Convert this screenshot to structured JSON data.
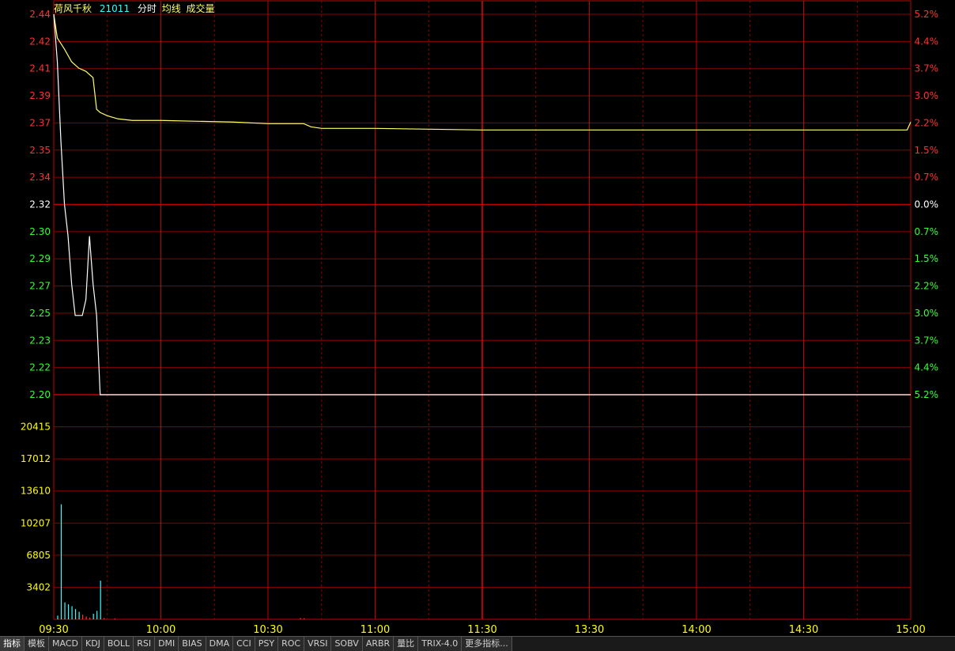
{
  "header": {
    "name": "荷风千秋",
    "code": "21011",
    "label_fenshi": "分时",
    "label_junxian": "均线",
    "label_volume": "成交量"
  },
  "colors": {
    "grid": "#8b0000",
    "grid_major": "#c00000",
    "price_line": "#ffffff",
    "avg_line": "#ffff66",
    "up": "#ff3030",
    "down": "#33ff33",
    "flat": "#ffffff",
    "volume_axis": "#ffff00",
    "volume_bar": "#33ffff",
    "volume_bar_red": "#ff3030",
    "time_label": "#ffff00"
  },
  "chart_data": {
    "type": "line",
    "prev_close": 2.32,
    "price_levels": [
      {
        "price": "2.44",
        "pct": "5.2%",
        "dir": "up"
      },
      {
        "price": "2.42",
        "pct": "4.4%",
        "dir": "up"
      },
      {
        "price": "2.41",
        "pct": "3.7%",
        "dir": "up"
      },
      {
        "price": "2.39",
        "pct": "3.0%",
        "dir": "up"
      },
      {
        "price": "2.37",
        "pct": "2.2%",
        "dir": "up"
      },
      {
        "price": "2.35",
        "pct": "1.5%",
        "dir": "up"
      },
      {
        "price": "2.34",
        "pct": "0.7%",
        "dir": "up"
      },
      {
        "price": "2.32",
        "pct": "0.0%",
        "dir": "flat"
      },
      {
        "price": "2.30",
        "pct": "0.7%",
        "dir": "down"
      },
      {
        "price": "2.29",
        "pct": "1.5%",
        "dir": "down"
      },
      {
        "price": "2.27",
        "pct": "2.2%",
        "dir": "down"
      },
      {
        "price": "2.25",
        "pct": "3.0%",
        "dir": "down"
      },
      {
        "price": "2.23",
        "pct": "3.7%",
        "dir": "down"
      },
      {
        "price": "2.22",
        "pct": "4.4%",
        "dir": "down"
      },
      {
        "price": "2.20",
        "pct": "5.2%",
        "dir": "down"
      }
    ],
    "price_range": [
      2.2,
      2.44
    ],
    "volume_ticks": [
      "20415",
      "17012",
      "13610",
      "10207",
      "6805",
      "3402"
    ],
    "volume_tick_values": [
      20415,
      17012,
      13610,
      10207,
      6805,
      3402
    ],
    "volume_max": 23817,
    "time_labels": [
      "09:30",
      "10:00",
      "10:30",
      "11:00",
      "11:30",
      "13:30",
      "14:00",
      "14:30",
      "15:00"
    ],
    "total_minutes": 240,
    "price_series": [
      [
        0,
        2.44
      ],
      [
        1,
        2.41
      ],
      [
        2,
        2.36
      ],
      [
        3,
        2.32
      ],
      [
        4,
        2.3
      ],
      [
        5,
        2.27
      ],
      [
        6,
        2.25
      ],
      [
        7,
        2.25
      ],
      [
        8,
        2.25
      ],
      [
        9,
        2.26
      ],
      [
        10,
        2.3
      ],
      [
        11,
        2.27
      ],
      [
        12,
        2.25
      ],
      [
        13,
        2.2
      ],
      [
        30,
        2.2
      ],
      [
        60,
        2.2
      ],
      [
        90,
        2.2
      ],
      [
        120,
        2.2
      ],
      [
        150,
        2.2
      ],
      [
        180,
        2.2
      ],
      [
        210,
        2.2
      ],
      [
        240,
        2.2
      ]
    ],
    "avg_series": [
      [
        0,
        2.44
      ],
      [
        1,
        2.425
      ],
      [
        3,
        2.418
      ],
      [
        5,
        2.41
      ],
      [
        7,
        2.406
      ],
      [
        9,
        2.404
      ],
      [
        11,
        2.4
      ],
      [
        12,
        2.38
      ],
      [
        13,
        2.378
      ],
      [
        15,
        2.376
      ],
      [
        18,
        2.374
      ],
      [
        22,
        2.373
      ],
      [
        30,
        2.373
      ],
      [
        50,
        2.372
      ],
      [
        60,
        2.371
      ],
      [
        70,
        2.371
      ],
      [
        72,
        2.369
      ],
      [
        75,
        2.368
      ],
      [
        90,
        2.368
      ],
      [
        120,
        2.367
      ],
      [
        150,
        2.367
      ],
      [
        180,
        2.367
      ],
      [
        210,
        2.367
      ],
      [
        239,
        2.367
      ],
      [
        240,
        2.372
      ]
    ],
    "volume_series": [
      [
        0,
        400,
        "c"
      ],
      [
        1,
        12200,
        "c"
      ],
      [
        2,
        1800,
        "c"
      ],
      [
        3,
        1600,
        "c"
      ],
      [
        4,
        1400,
        "c"
      ],
      [
        5,
        1100,
        "c"
      ],
      [
        6,
        800,
        "c"
      ],
      [
        7,
        500,
        "r"
      ],
      [
        8,
        300,
        "r"
      ],
      [
        9,
        200,
        "r"
      ],
      [
        10,
        600,
        "c"
      ],
      [
        11,
        900,
        "c"
      ],
      [
        12,
        4100,
        "c"
      ],
      [
        13,
        150,
        "r"
      ],
      [
        16,
        100,
        "r"
      ],
      [
        68,
        150,
        "r"
      ],
      [
        69,
        120,
        "r"
      ]
    ]
  },
  "toolbar": {
    "items": [
      "指标",
      "模板",
      "MACD",
      "KDJ",
      "BOLL",
      "RSI",
      "DMI",
      "BIAS",
      "DMA",
      "CCI",
      "PSY",
      "ROC",
      "VRSI",
      "SOBV",
      "ARBR",
      "量比",
      "TRIX-4.0",
      "更多指标..."
    ]
  }
}
